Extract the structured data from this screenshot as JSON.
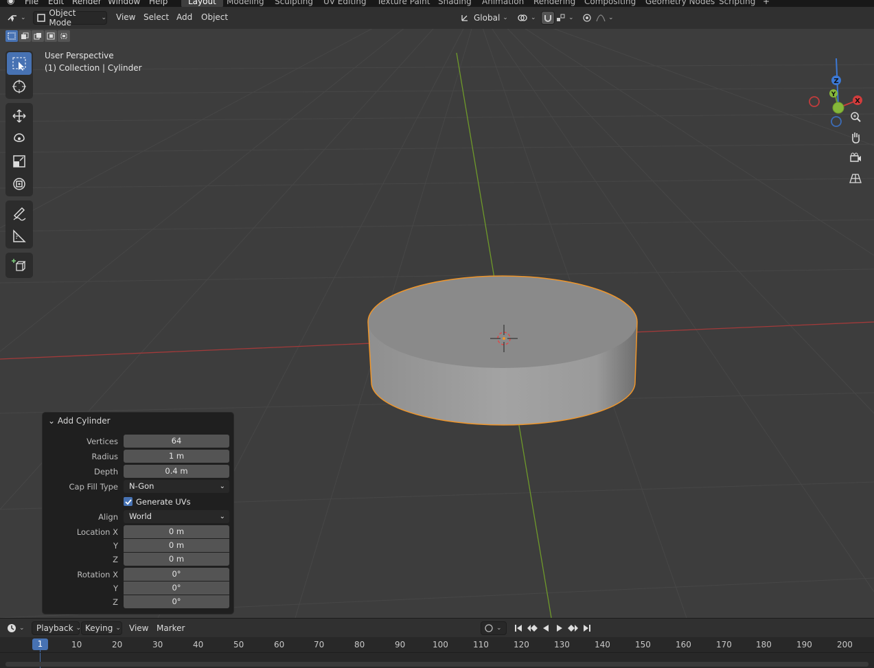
{
  "topbar": {
    "menus": [
      "File",
      "Edit",
      "Render",
      "Window",
      "Help"
    ],
    "workspaces": [
      "Layout",
      "Modeling",
      "Sculpting",
      "UV Editing",
      "Texture Paint",
      "Shading",
      "Animation",
      "Rendering",
      "Compositing",
      "Geometry Nodes",
      "Scripting"
    ],
    "active_workspace": "Layout",
    "add_tab": "+"
  },
  "header": {
    "mode": "Object Mode",
    "menus": [
      "View",
      "Select",
      "Add",
      "Object"
    ],
    "transform_orientation": "Global"
  },
  "viewport": {
    "view_name": "User Perspective",
    "collection_info": "(1) Collection | Cylinder",
    "colors": {
      "background": "#3d3d3d",
      "x_axis": "#a33a3a",
      "y_axis": "#6f9a2a",
      "selection_outline": "#f0962a",
      "accent": "#4772b3"
    }
  },
  "gizmo": {
    "z": "Z",
    "y": "Y",
    "x": "X"
  },
  "operator_panel": {
    "title": "Add Cylinder",
    "vertices_label": "Vertices",
    "vertices": "64",
    "radius_label": "Radius",
    "radius": "1 m",
    "depth_label": "Depth",
    "depth": "0.4 m",
    "cap_fill_label": "Cap Fill Type",
    "cap_fill": "N-Gon",
    "generate_uvs_label": "Generate UVs",
    "generate_uvs": true,
    "align_label": "Align",
    "align": "World",
    "location_x_label": "Location X",
    "location_x": "0 m",
    "location_y_label": "Y",
    "location_y": "0 m",
    "location_z_label": "Z",
    "location_z": "0 m",
    "rotation_x_label": "Rotation X",
    "rotation_x": "0°",
    "rotation_y_label": "Y",
    "rotation_y": "0°",
    "rotation_z_label": "Z",
    "rotation_z": "0°"
  },
  "timeline": {
    "menus": [
      "Playback",
      "Keying",
      "View",
      "Marker"
    ],
    "current_frame": "1",
    "ticks": [
      "10",
      "20",
      "30",
      "40",
      "50",
      "60",
      "70",
      "80",
      "90",
      "100",
      "110",
      "120",
      "130",
      "140",
      "150",
      "160",
      "170",
      "180",
      "190",
      "200"
    ]
  }
}
